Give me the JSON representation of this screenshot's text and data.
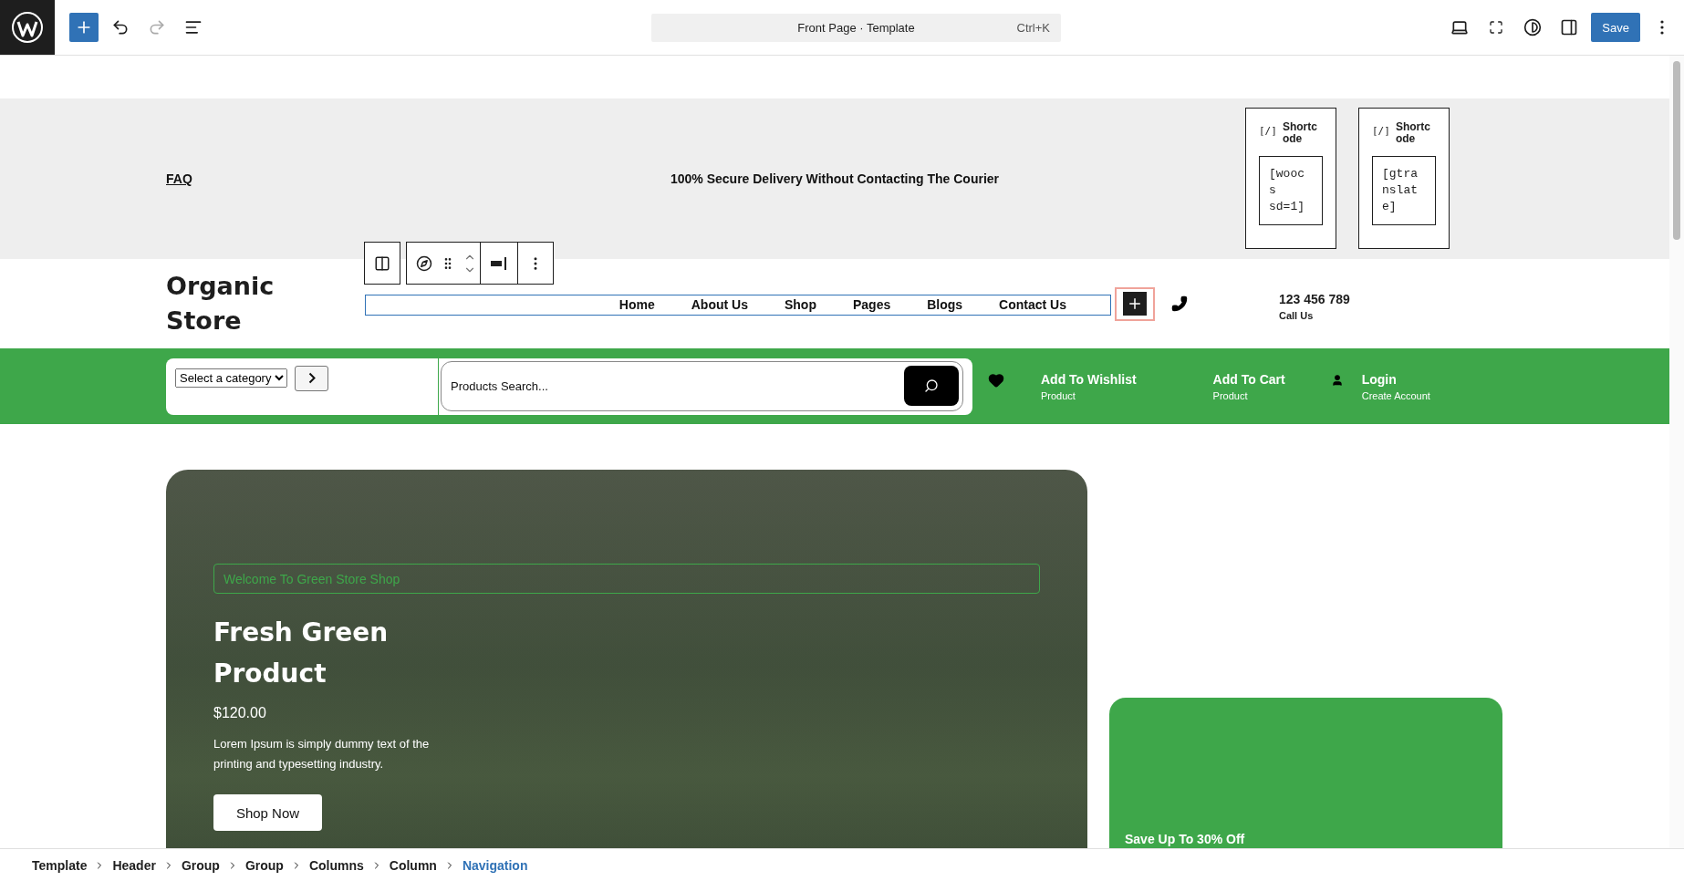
{
  "topbar": {
    "document_title": "Front Page · Template",
    "shortcut": "Ctrl+K",
    "save": "Save"
  },
  "top_strip": {
    "faq": "FAQ",
    "message": "100% Secure Delivery Without Contacting The Courier",
    "shortcodes": [
      {
        "icon": "[/]",
        "label": "Shortcode",
        "content": "[woocs sd=1]"
      },
      {
        "icon": "[/]",
        "label": "Shortcode",
        "content": "[gtranslate]"
      }
    ]
  },
  "header": {
    "logo": "Organic Store",
    "nav": [
      {
        "label": "Home"
      },
      {
        "label": "About Us"
      },
      {
        "label": "Shop"
      },
      {
        "label": "Pages"
      },
      {
        "label": "Blogs"
      },
      {
        "label": "Contact Us"
      }
    ],
    "phone": "123 456 789",
    "phone_label": "Call Us"
  },
  "shop_bar": {
    "category": "Select a category",
    "search_placeholder": "Products Search...",
    "actions": [
      {
        "kind": "wishlist",
        "title": "Add To Wishlist",
        "subtitle": "Product"
      },
      {
        "kind": "cart",
        "title": "Add To Cart",
        "subtitle": "Product"
      },
      {
        "kind": "account",
        "title": "Login",
        "subtitle": "Create Account"
      }
    ]
  },
  "hero": {
    "tag": "Welcome To Green Store Shop",
    "title": "Fresh Green Product",
    "price": "$120.00",
    "description": "Lorem Ipsum is simply dummy text of the printing and typesetting industry.",
    "button": "Shop Now"
  },
  "promo": {
    "text": "Save Up To 30% Off"
  },
  "breadcrumb": [
    {
      "label": "Template",
      "selected": false
    },
    {
      "label": "Header",
      "selected": false
    },
    {
      "label": "Group",
      "selected": false
    },
    {
      "label": "Group",
      "selected": false
    },
    {
      "label": "Columns",
      "selected": false
    },
    {
      "label": "Column",
      "selected": false
    },
    {
      "label": "Navigation",
      "selected": true
    }
  ]
}
